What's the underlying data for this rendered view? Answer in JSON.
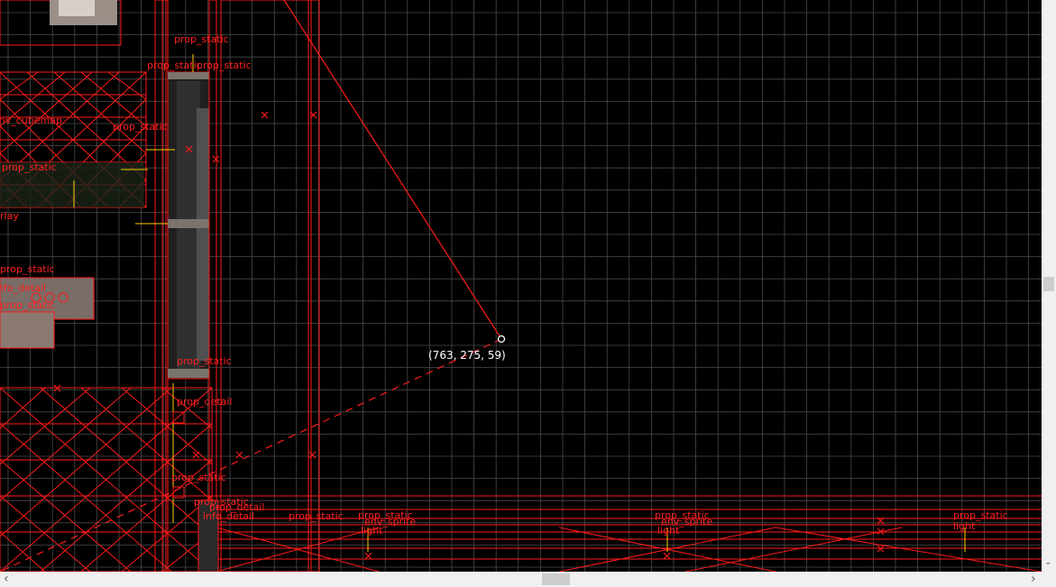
{
  "viewport": {
    "cursor_readout": "(763, 275, 59)",
    "entity_labels": [
      {
        "id": "l1",
        "text": "prop_static"
      },
      {
        "id": "l2",
        "text": "prop_static"
      },
      {
        "id": "l3",
        "text": "prop_static"
      },
      {
        "id": "l4",
        "text": "env_cubemap"
      },
      {
        "id": "l5",
        "text": "prop_static"
      },
      {
        "id": "l6",
        "text": "prop_static"
      },
      {
        "id": "l7",
        "text": "overlay"
      },
      {
        "id": "l8",
        "text": "prop_static"
      },
      {
        "id": "l9",
        "text": "info_detail"
      },
      {
        "id": "l10",
        "text": "prop_static"
      },
      {
        "id": "l11",
        "text": "prop_static"
      },
      {
        "id": "l12",
        "text": "prop_detail"
      },
      {
        "id": "l13",
        "text": "prop_static"
      },
      {
        "id": "l14",
        "text": "prop_static"
      },
      {
        "id": "l15",
        "text": "prop_detail"
      },
      {
        "id": "l16",
        "text": "info_detail"
      },
      {
        "id": "l17",
        "text": "prop_static"
      },
      {
        "id": "l18",
        "text": "prop_static"
      },
      {
        "id": "l19",
        "text": "env_sprite"
      },
      {
        "id": "l20",
        "text": "light"
      },
      {
        "id": "l21",
        "text": "prop_static"
      },
      {
        "id": "l22",
        "text": "env_sprite"
      },
      {
        "id": "l23",
        "text": "light"
      },
      {
        "id": "l24",
        "text": "prop_static"
      },
      {
        "id": "l25",
        "text": "light"
      }
    ]
  },
  "scrollbars": {
    "left_arrow": "‹",
    "right_arrow": "›",
    "down_arrow": "⌄"
  },
  "colors": {
    "grid": "#4a4a4a",
    "geometry": "#ff1a1a",
    "entity_marker": "#ffd000",
    "background": "#000000"
  }
}
